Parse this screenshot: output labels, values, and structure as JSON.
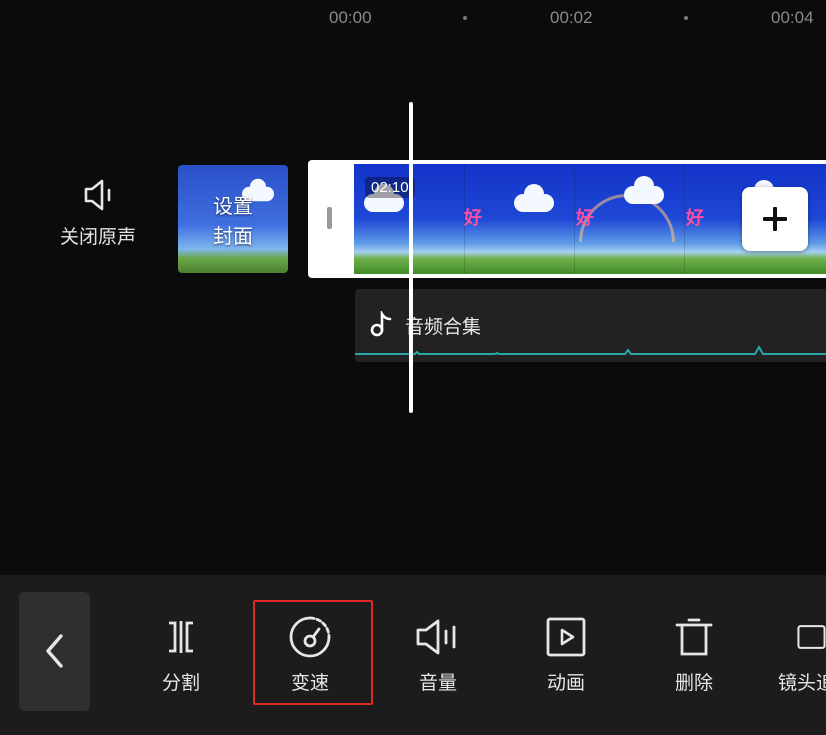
{
  "ruler": {
    "labels": [
      "00:00",
      "00:02",
      "00:04"
    ]
  },
  "timeline": {
    "mute_label": "关闭原声",
    "cover_label_line1": "设置",
    "cover_label_line2": "封面",
    "clip_duration": "02:10",
    "clip_overlay_text": "好",
    "audio_track_name": "音频合集"
  },
  "toolbar": {
    "tools": [
      {
        "label": "分割",
        "icon": "split-icon"
      },
      {
        "label": "变速",
        "icon": "speed-icon",
        "highlighted": true
      },
      {
        "label": "音量",
        "icon": "volume-icon"
      },
      {
        "label": "动画",
        "icon": "animation-icon"
      },
      {
        "label": "删除",
        "icon": "delete-icon"
      },
      {
        "label": "镜头追",
        "icon": "camera-track-icon"
      }
    ]
  },
  "colors": {
    "background": "#0b0b0b",
    "toolbar_bg": "#1c1c1c",
    "highlight": "#e02828",
    "audio_wave": "#2aa6a6"
  }
}
